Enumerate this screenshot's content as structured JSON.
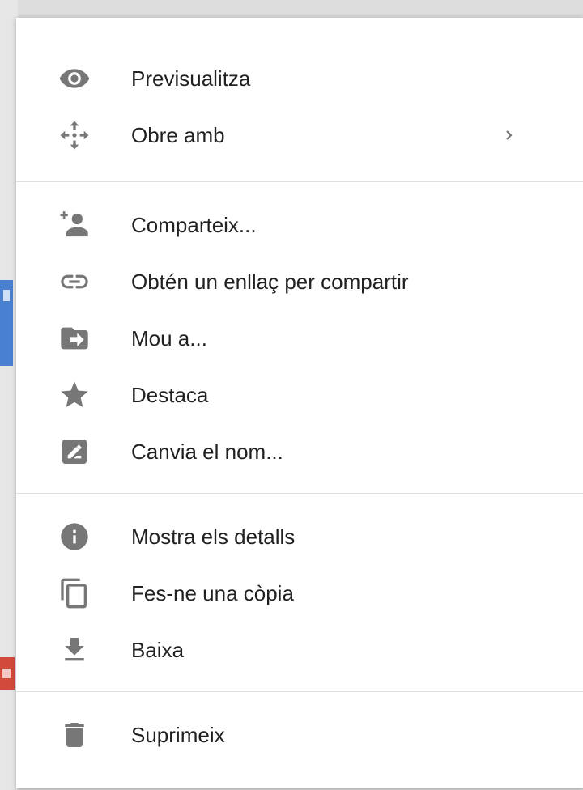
{
  "menu": {
    "groups": [
      {
        "items": [
          {
            "label": "Previsualitza",
            "icon": "eye-icon"
          },
          {
            "label": "Obre amb",
            "icon": "open-with-icon",
            "submenu": true
          }
        ]
      },
      {
        "items": [
          {
            "label": "Comparteix...",
            "icon": "person-add-icon"
          },
          {
            "label": "Obtén un enllaç per compartir",
            "icon": "link-icon"
          },
          {
            "label": "Mou a...",
            "icon": "folder-move-icon"
          },
          {
            "label": "Destaca",
            "icon": "star-icon"
          },
          {
            "label": "Canvia el nom...",
            "icon": "rename-icon"
          }
        ]
      },
      {
        "items": [
          {
            "label": "Mostra els detalls",
            "icon": "info-icon"
          },
          {
            "label": "Fes-ne una còpia",
            "icon": "copy-icon"
          },
          {
            "label": "Baixa",
            "icon": "download-icon"
          }
        ]
      },
      {
        "items": [
          {
            "label": "Suprimeix",
            "icon": "trash-icon"
          }
        ]
      }
    ]
  },
  "colors": {
    "icon": "#777777",
    "text": "#212121",
    "divider": "#e0e0e0",
    "menu_background": "#ffffff"
  }
}
